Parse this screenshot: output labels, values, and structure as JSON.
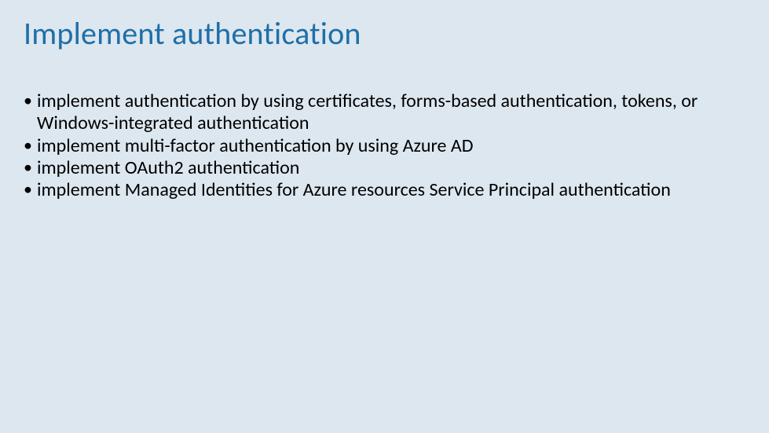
{
  "title": "Implement authentication",
  "bullets": [
    "implement authentication by using certificates, forms-based authentication, tokens, or Windows-integrated authentication",
    "implement multi-factor authentication by using Azure AD",
    "implement OAuth2 authentication",
    "implement Managed Identities for Azure resources Service Principal authentication"
  ]
}
